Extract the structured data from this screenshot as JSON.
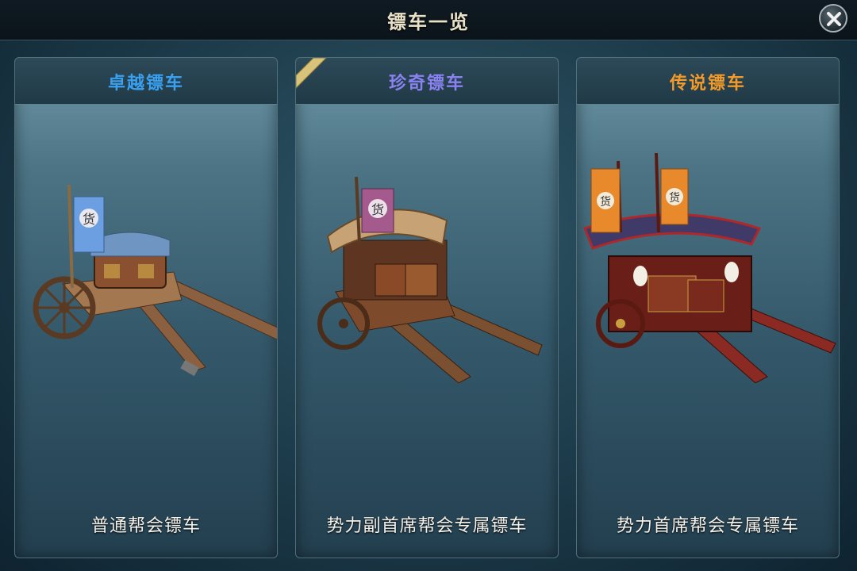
{
  "window": {
    "title": "镖车一览"
  },
  "cards": [
    {
      "title": "卓越镖车",
      "description": "普通帮会镖车",
      "title_color": "#3aa0f0",
      "flag_color": "#6c9ee2",
      "flag_char": "货"
    },
    {
      "title": "珍奇镖车",
      "description": "势力副首席帮会专属镖车",
      "title_color": "#8a82f0",
      "flag_color": "#a45a8c",
      "flag_char": "货",
      "badge_icon": "ribbon-tag-icon"
    },
    {
      "title": "传说镖车",
      "description": "势力首席帮会专属镖车",
      "title_color": "#f29a2a",
      "flag_color": "#e88a2c",
      "flag_char": "货"
    }
  ],
  "icons": {
    "close": "close-icon"
  }
}
